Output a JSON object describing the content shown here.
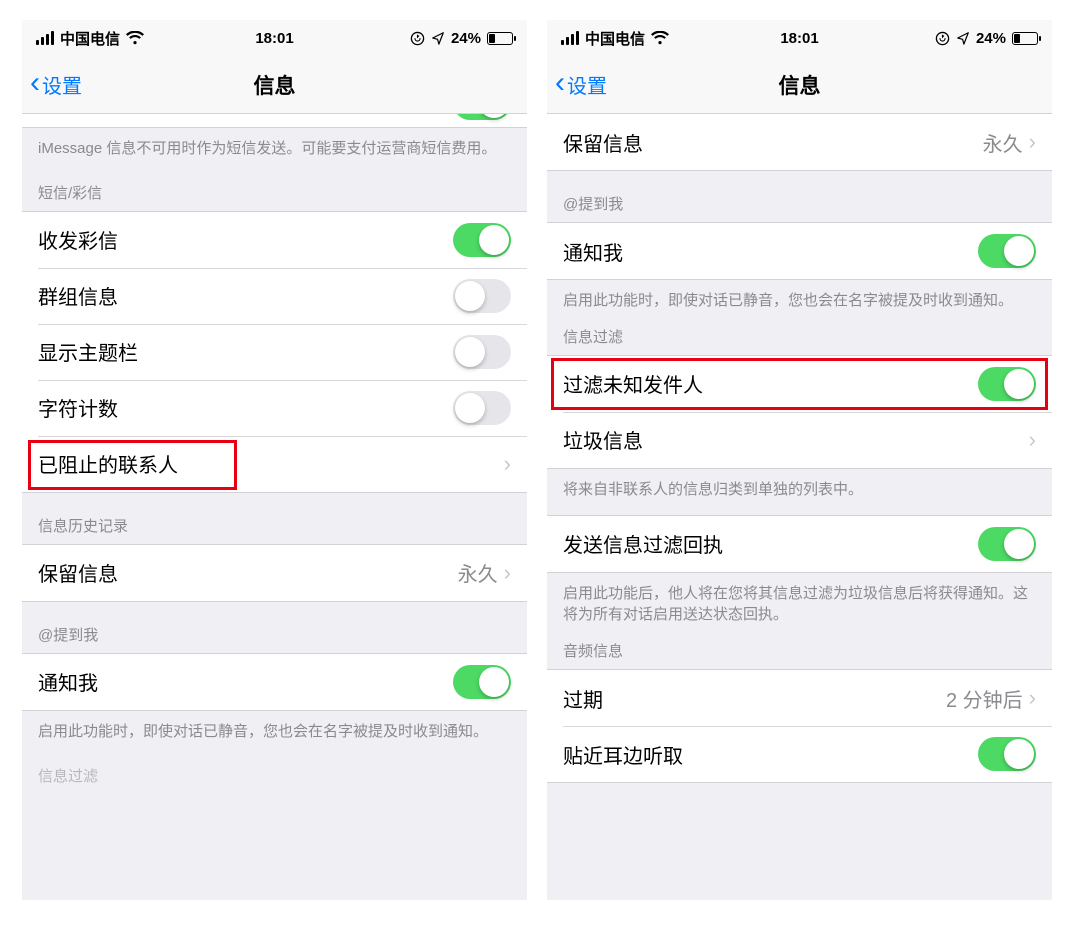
{
  "status": {
    "carrier": "中国电信",
    "time": "18:01",
    "battery_pct": "24%"
  },
  "nav": {
    "back": "设置",
    "title": "信息"
  },
  "left": {
    "imessage_note": "iMessage 信息不可用时作为短信发送。可能要支付运营商短信费用。",
    "sms_header": "短信/彩信",
    "mms": "收发彩信",
    "group": "群组信息",
    "subject": "显示主题栏",
    "charcount": "字符计数",
    "blocked": "已阻止的联系人",
    "history_header": "信息历史记录",
    "keep": "保留信息",
    "keep_val": "永久",
    "mention_header": "@提到我",
    "notify_me": "通知我",
    "notify_note": "启用此功能时，即使对话已静音，您也会在名字被提及时收到通知。",
    "filter_header_partial": "信息过滤"
  },
  "right": {
    "keep": "保留信息",
    "keep_val": "永久",
    "mention_header": "@提到我",
    "notify_me": "通知我",
    "notify_note": "启用此功能时，即使对话已静音，您也会在名字被提及时收到通知。",
    "filter_header": "信息过滤",
    "filter_unknown": "过滤未知发件人",
    "junk": "垃圾信息",
    "filter_note": "将来自非联系人的信息归类到单独的列表中。",
    "send_receipt": "发送信息过滤回执",
    "send_receipt_note": "启用此功能后，他人将在您将其信息过滤为垃圾信息后将获得通知。这将为所有对话启用送达状态回执。",
    "audio_header": "音频信息",
    "expire": "过期",
    "expire_val": "2 分钟后",
    "raise": "贴近耳边听取"
  }
}
